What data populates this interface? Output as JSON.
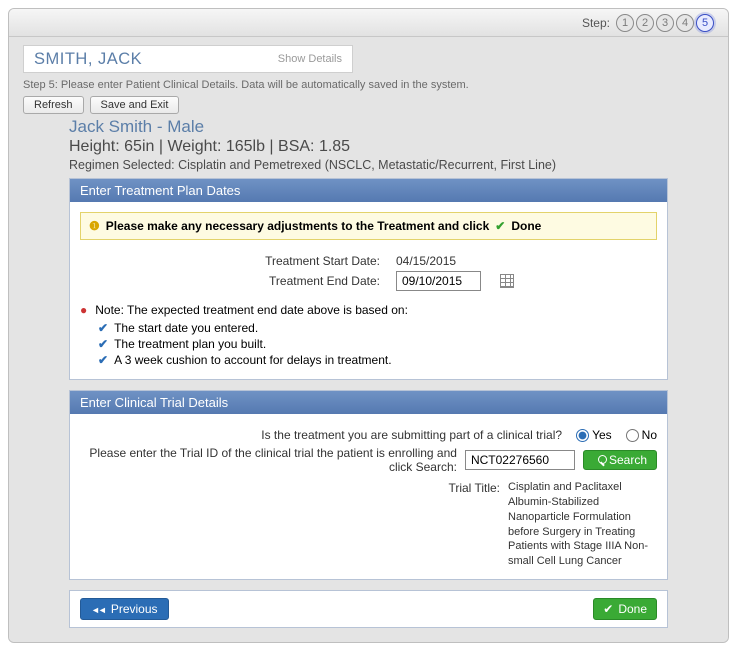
{
  "stepbar": {
    "label": "Step:",
    "steps": [
      "1",
      "2",
      "3",
      "4",
      "5"
    ],
    "active": 5
  },
  "patient_header": {
    "name": "SMITH, JACK",
    "show_details": "Show Details"
  },
  "instruction": "Step 5: Please enter Patient Clinical Details. Data will be automatically saved in the system.",
  "buttons": {
    "refresh": "Refresh",
    "save_exit": "Save and Exit",
    "previous": "Previous",
    "done": "Done",
    "search": "Search"
  },
  "patient": {
    "display_name": "Jack Smith - Male",
    "measures": "Height: 65in  |  Weight: 165lb  |  BSA: 1.85",
    "regimen_label": "Regimen Selected: ",
    "regimen_value": "Cisplatin and Pemetrexed (NSCLC, Metastatic/Recurrent, First Line)"
  },
  "panel_dates": {
    "title": "Enter Treatment Plan Dates",
    "info_prefix": "Please make any necessary adjustments to the Treatment and click",
    "info_done": "Done",
    "start_label": "Treatment Start Date:",
    "start_value": "04/15/2015",
    "end_label": "Treatment End Date:",
    "end_value": "09/10/2015",
    "note_label": "Note: The expected treatment end date above is based on:",
    "bullets": [
      "The start date you entered.",
      "The treatment plan you built.",
      "A 3 week cushion to account for delays in treatment."
    ]
  },
  "panel_trial": {
    "title": "Enter Clinical Trial Details",
    "q1": "Is the treatment you are submitting part of a clinical trial?",
    "yes": "Yes",
    "no": "No",
    "q2": "Please enter the Trial ID of the clinical trial the patient is enrolling and click Search:",
    "trial_id": "NCT02276560",
    "trial_title_label": "Trial Title:",
    "trial_title_value": "Cisplatin and Paclitaxel Albumin-Stabilized Nanoparticle Formulation before Surgery in Treating Patients with Stage IIIA Non-small Cell Lung Cancer"
  }
}
